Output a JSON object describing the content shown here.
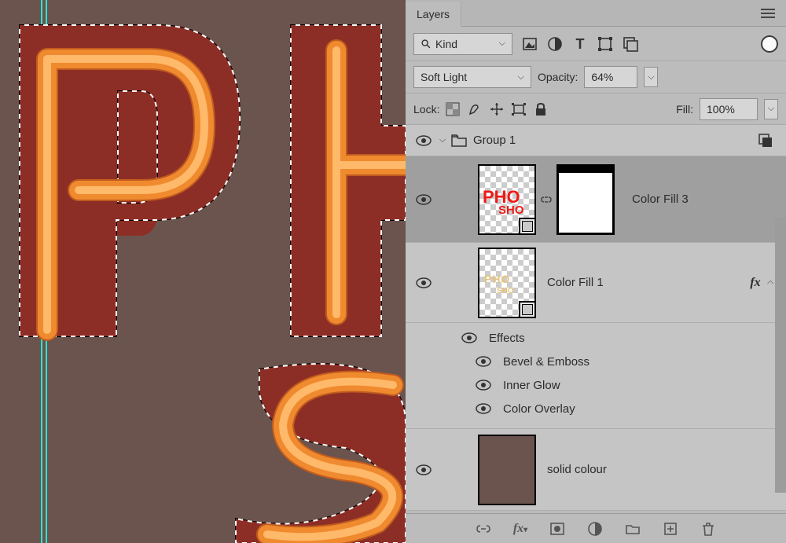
{
  "panel": {
    "title": "Layers",
    "filter": {
      "kind": "Kind",
      "icons": [
        "image-filter-icon",
        "adjustment-filter-icon",
        "type-filter-icon",
        "shape-filter-icon",
        "smartobject-filter-icon"
      ]
    },
    "blend_mode": "Soft Light",
    "opacity_label": "Opacity:",
    "opacity_value": "64%",
    "lock_label": "Lock:",
    "fill_label": "Fill:",
    "fill_value": "100%",
    "group": {
      "name": "Group 1",
      "layers": [
        {
          "name": "Color Fill 3",
          "thumb_text_1": "PHO",
          "thumb_text_2": "SHO",
          "selected": true,
          "has_mask": true
        },
        {
          "name": "Color Fill 1",
          "fx": true,
          "effects_title": "Effects",
          "effects": [
            "Bevel & Emboss",
            "Inner Glow",
            "Color Overlay"
          ]
        },
        {
          "name": "solid colour",
          "solid": "#6a544d"
        }
      ]
    }
  },
  "canvas": {
    "guides": [
      53,
      57
    ],
    "letters": [
      "P",
      "H",
      "S"
    ]
  }
}
